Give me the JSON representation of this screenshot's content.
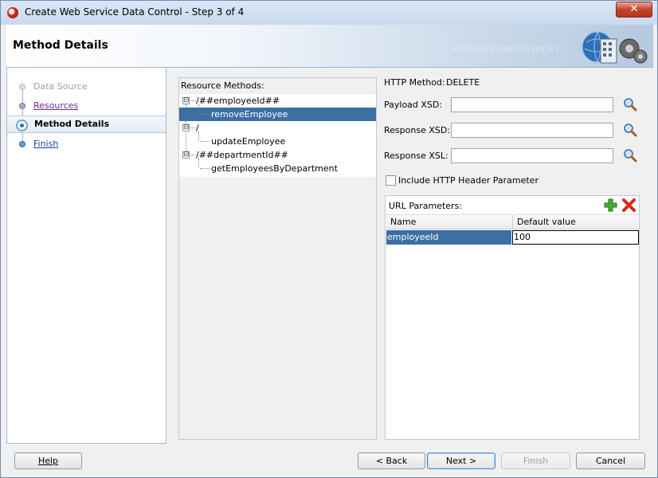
{
  "window": {
    "title": "Create Web Service Data Control - Step 3 of 4",
    "close_glyph": "✕"
  },
  "header": {
    "title": "Method Details",
    "binary_text": "01010101010101010101101"
  },
  "nav": {
    "items": [
      {
        "label": "Data Source",
        "state": "disabled"
      },
      {
        "label": "Resources",
        "state": "visited"
      },
      {
        "label": "Method Details",
        "state": "active"
      },
      {
        "label": "Finish",
        "state": "link"
      }
    ]
  },
  "tree": {
    "header": "Resource Methods:",
    "rows": [
      {
        "label": "/##employeeId##",
        "expander": "⊟"
      },
      {
        "label": "removeEmployee"
      },
      {
        "label": "/",
        "expander": "⊟"
      },
      {
        "label": "updateEmployee"
      },
      {
        "label": "/##departmentId##",
        "expander": "⊟"
      },
      {
        "label": "getEmployeesByDepartment"
      }
    ]
  },
  "method": {
    "http_method_label": "HTTP Method:",
    "http_method_value": "DELETE",
    "payload_xsd_label": "Payload XSD:",
    "payload_xsd_value": "",
    "response_xsd_label": "Response XSD:",
    "response_xsd_value": "",
    "response_xsl_label": "Response XSL:",
    "response_xsl_value": "",
    "include_header_label": "Include HTTP Header Parameter",
    "include_header_checked": false
  },
  "url_params": {
    "title": "URL Parameters:",
    "columns": [
      "Name",
      "Default value"
    ],
    "rows": [
      {
        "name": "employeeId",
        "default": "100"
      }
    ]
  },
  "buttons": {
    "help": "Help",
    "back": "< Back",
    "next": "Next >",
    "finish": "Finish",
    "cancel": "Cancel"
  },
  "colors": {
    "selection": "#3c6fa3",
    "accent": "#5d9bd8"
  },
  "icons": [
    "search-icon",
    "add-icon",
    "delete-icon",
    "close-icon",
    "app-icon"
  ]
}
